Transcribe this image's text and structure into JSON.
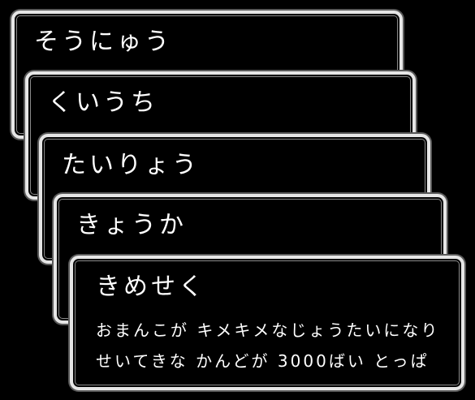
{
  "skill_menu": {
    "windows": [
      {
        "title": "そうにゅう"
      },
      {
        "title": "くいうち"
      },
      {
        "title": "たいりょう"
      },
      {
        "title": "きょうか"
      },
      {
        "title": "きめせく"
      }
    ],
    "description": {
      "line1": "おまんこが キメキメなじょうたいになり",
      "line2": "せいてきな かんどが 3000ばい とっぱ"
    },
    "colors": {
      "background": "#000000",
      "border": "#e6e6e6",
      "text": "#ffffff"
    }
  }
}
